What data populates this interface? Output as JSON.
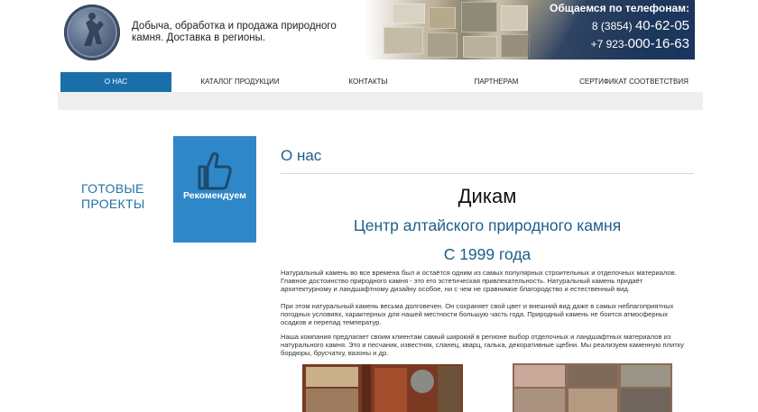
{
  "header": {
    "tagline": "Добыча, обработка и продажа природного камня. Доставка в регионы.",
    "phone_title": "Общаемся по телефонам:",
    "phone1_prefix": "8 (3854) ",
    "phone1_main": "40-62-05",
    "phone2_prefix": "+7 923-",
    "phone2_main": "000-16-63"
  },
  "nav": {
    "items": [
      {
        "label": "О НАС",
        "active": true
      },
      {
        "label": "КАТАЛОГ ПРОДУКЦИИ",
        "active": false
      },
      {
        "label": "КОНТАКТЫ",
        "active": false
      },
      {
        "label": "ПАРТНЕРАМ",
        "active": false
      },
      {
        "label": "СЕРТИФИКАТ СООТВЕТСТВИЯ",
        "active": false
      }
    ]
  },
  "sidebar": {
    "ready_projects": "ГОТОВЫЕ ПРОЕКТЫ",
    "recommend_label": "Рекомендуем",
    "recommend_icon": "thumbs-up-icon"
  },
  "main": {
    "title": "О нас",
    "company": "Дикам",
    "subtitle": "Центр алтайского природного камня",
    "since": "С 1999 года",
    "paragraphs": [
      "Натуральный камень во все времена был и остаётся одним из самых популярных строительных и отделочных материалов. Главное достоинство природного камня - это его эстетическая привлекательность. Натуральный камень придаёт архитектурному и ландшафтному дизайну особое, ни с чем не сравнимое благородство и естественный вид.",
      "При этом натуральный камень весьма долговечен. Он сохраняет свой цвет и внешний вид даже в самых неблагоприятных погодных условиях, характерных для нашей местности большую часть года. Природный камень не боится атмосферных осадков и перепад температур.",
      "Наша компания предлагает своим клиентам самый широкий в регионе выбор отделочных и ландшафтных материалов из натурального камня. Это и песчаник, известняк, сланец, кварц, галька, декоративные щебни. Мы реализуем каменную плитку бордюры, брусчатку, вазоны и др."
    ]
  },
  "colors": {
    "accent": "#1a6fa8",
    "heading": "#1d5f8a",
    "tile": "#2f87c8"
  }
}
